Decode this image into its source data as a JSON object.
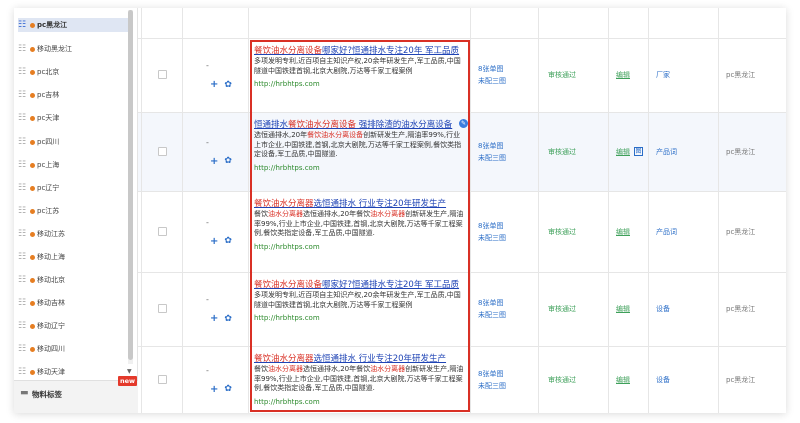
{
  "sidebar": {
    "items": [
      {
        "label": "pc黑龙江",
        "selected": true
      },
      {
        "label": "移动黑龙江"
      },
      {
        "label": "pc北京"
      },
      {
        "label": "pc吉林"
      },
      {
        "label": "pc天津"
      },
      {
        "label": "pc四川"
      },
      {
        "label": "pc上海"
      },
      {
        "label": "pc辽宁"
      },
      {
        "label": "pc江苏"
      },
      {
        "label": "移动江苏"
      },
      {
        "label": "移动上海"
      },
      {
        "label": "移动北京"
      },
      {
        "label": "移动吉林"
      },
      {
        "label": "移动辽宁"
      },
      {
        "label": "移动四川"
      },
      {
        "label": "移动天津"
      }
    ],
    "bottom_label": "物料标签",
    "new_badge": "new"
  },
  "rows": [
    {
      "dash": "-",
      "title_parts": [
        "",
        "餐饮油水分离设备",
        "哪家好?恒通排水专注20年 ",
        "",
        "军工品质"
      ],
      "desc_parts": [
        "多项发明专利,近百项自主知识产权,20余年研发生产,军工品质,中国隧道中国铁建首钢,北京大剧院,万达等千家工程案例"
      ],
      "url": "http://hrbhtps.com",
      "img1": "8张单图",
      "img2": "未配三图",
      "status": "审核通过",
      "edit": "编辑",
      "tag": "厂家",
      "unit": "pc黑龙江"
    },
    {
      "dash": "-",
      "title_parts": [
        "恒通排水",
        "餐饮油水分离设备",
        " 强排除渣的油水分离设备"
      ],
      "desc_parts": [
        "选恒通排水,20年",
        "餐饮油水分离设备",
        "创新研发生产,隔油率99%,行业上市企业,中国铁建,首钢,北京大剧院,万达等千家工程案例,餐饮类指定设备,军工品质,中国隧道."
      ],
      "url": "http://hrbhtps.com",
      "img1": "8张单图",
      "img2": "未配三图",
      "status": "审核通过",
      "edit": "编辑",
      "mini_icon": "图",
      "tag": "产品词",
      "unit": "pc黑龙江"
    },
    {
      "dash": "-",
      "title_parts": [
        "",
        "餐饮油水分离器",
        "选恒通排水  行业专注20年研发生产"
      ],
      "desc_parts": [
        "餐饮",
        "油水分离器",
        "选恒通排水,20年餐饮",
        "油水分离器",
        "创新研发生产,隔油率99%,行业上市企业,中国铁建,首钢,北京大剧院,万达等千家工程案例,餐饮类指定设备,军工品质,中国隧道."
      ],
      "url": "http://hrbhtps.com",
      "img1": "8张单图",
      "img2": "未配三图",
      "status": "审核通过",
      "edit": "编辑",
      "tag": "产品词",
      "unit": "pc黑龙江"
    },
    {
      "dash": "-",
      "title_parts": [
        "",
        "餐饮油水分离设备",
        "哪家好?恒通排水专注20年 军工品质"
      ],
      "desc_parts": [
        "多项发明专利,近百项自主知识产权,20余年研发生产,军工品质,中国隧道中国铁建首钢,北京大剧院,万达等千家工程案例"
      ],
      "url": "http://hrbhtps.com",
      "img1": "8张单图",
      "img2": "未配三图",
      "status": "审核通过",
      "edit": "编辑",
      "tag": "设备",
      "unit": "pc黑龙江"
    },
    {
      "dash": "-",
      "title_parts": [
        "",
        "餐饮油水分离器",
        "选恒通排水 行业专注20年研发生产"
      ],
      "desc_parts": [
        "餐饮",
        "油水分离器",
        "选恒通排水,20年餐饮",
        "油水分离器",
        "创新研发生产,隔油率99%,行业上市企业,中国铁建,首钢,北京大剧院,万达等千家工程案例,餐饮类指定设备,军工品质,中国隧道."
      ],
      "url": "http://hrbhtps.com",
      "img1": "8张单图",
      "img2": "未配三图",
      "status": "审核通过",
      "edit": "编辑",
      "tag": "设备",
      "unit": "pc黑龙江"
    }
  ],
  "actions": {
    "add_icon": "plus-icon",
    "settings_icon": "gear-icon"
  },
  "colors": {
    "highlight": "#d93025",
    "link": "#1f44b5",
    "status_green": "#3ea05a",
    "box_red": "#d93025"
  }
}
